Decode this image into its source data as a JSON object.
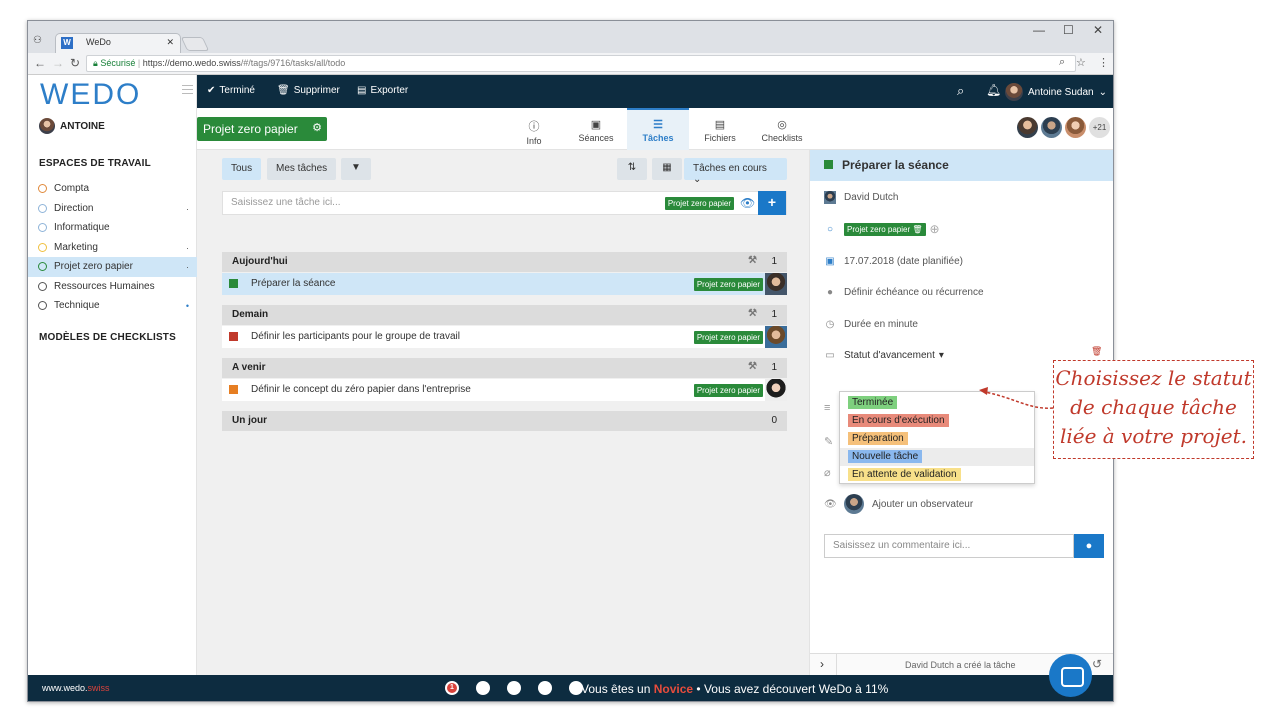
{
  "browser": {
    "tab_title": "WeDo",
    "tab_icon": "W",
    "secure_label": "Sécurisé",
    "url_host": "https://demo.wedo.swiss",
    "url_path": "/#/tags/9716/tasks/all/todo"
  },
  "sidebar": {
    "logo": "WEDO",
    "user": "ANTOINE",
    "workspaces_header": "ESPACES DE TRAVAIL",
    "checklists_header": "MODÈLES DE CHECKLISTS",
    "items": [
      {
        "label": "Compta",
        "color": "#e08a3c",
        "suffix": ""
      },
      {
        "label": "Direction",
        "color": "#8fb4d9",
        "suffix": "·"
      },
      {
        "label": "Informatique",
        "color": "#8fb4d9",
        "suffix": ""
      },
      {
        "label": "Marketing",
        "color": "#f0c040",
        "suffix": "·"
      },
      {
        "label": "Projet zero papier",
        "color": "#2a8a3a",
        "suffix": "·"
      },
      {
        "label": "Ressources Humaines",
        "color": "#555",
        "suffix": ""
      },
      {
        "label": "Technique",
        "color": "#555",
        "suffix": "•"
      }
    ]
  },
  "topbar": {
    "done": "Terminé",
    "delete": "Supprimer",
    "export": "Exporter",
    "user": "Antoine Sudan"
  },
  "project": {
    "name": "Projet zero papier"
  },
  "tabs": [
    {
      "icon": "ⓘ",
      "label": "Info"
    },
    {
      "icon": "▣",
      "label": "Séances"
    },
    {
      "icon": "☰",
      "label": "Tâches"
    },
    {
      "icon": "▤",
      "label": "Fichiers"
    },
    {
      "icon": "◎",
      "label": "Checklists"
    }
  ],
  "members_more": "+21",
  "filters": {
    "all": "Tous",
    "mine": "Mes tâches",
    "status": "Tâches en cours"
  },
  "input": {
    "placeholder": "Saisissez une tâche ici...",
    "tag": "Projet zero papier"
  },
  "groups": [
    {
      "title": "Aujourd'hui",
      "count": "1",
      "tasks": [
        {
          "label": "Préparer la séance",
          "tag": "Projet zero papier",
          "color": "#2a8a3a"
        }
      ]
    },
    {
      "title": "Demain",
      "count": "1",
      "tasks": [
        {
          "label": "Définir les participants pour le groupe de travail",
          "tag": "Projet zero papier",
          "color": "#c0392b"
        }
      ]
    },
    {
      "title": "A venir",
      "count": "1",
      "tasks": [
        {
          "label": "Définir le concept du zéro papier dans l'entreprise",
          "tag": "Projet zero papier",
          "color": "#e67e22"
        }
      ]
    },
    {
      "title": "Un jour",
      "count": "0",
      "tasks": []
    }
  ],
  "detail": {
    "title": "Préparer la séance",
    "assignee": "David Dutch",
    "tag": "Projet zero papier",
    "date": "17.07.2018 (date planifiée)",
    "deadline": "Définir échéance ou récurrence",
    "duration": "Durée en minute",
    "status_label": "Statut d'avancement",
    "observer": "Ajouter un observateur",
    "comment_placeholder": "Saisissez un commentaire ici...",
    "log": "David Dutch a créé la tâche",
    "statuses": [
      {
        "label": "Terminée",
        "color": "#7ed07e"
      },
      {
        "label": "En cours d'exécution",
        "color": "#e88a7a"
      },
      {
        "label": "Préparation",
        "color": "#f5c07a"
      },
      {
        "label": "Nouvelle tâche",
        "color": "#8ab8ee"
      },
      {
        "label": "En attente de validation",
        "color": "#f8e08a"
      }
    ]
  },
  "footer": {
    "site": "www.wedo.",
    "site_accent": "swiss",
    "progress_pre": "Vous êtes un ",
    "level": "Novice",
    "progress_post": " • Vous avez découvert WeDo à 11%",
    "step": "1"
  },
  "callout": {
    "line1": "Choisissez le statut",
    "line2": "de chaque tâche",
    "line3": "liée à votre projet."
  }
}
